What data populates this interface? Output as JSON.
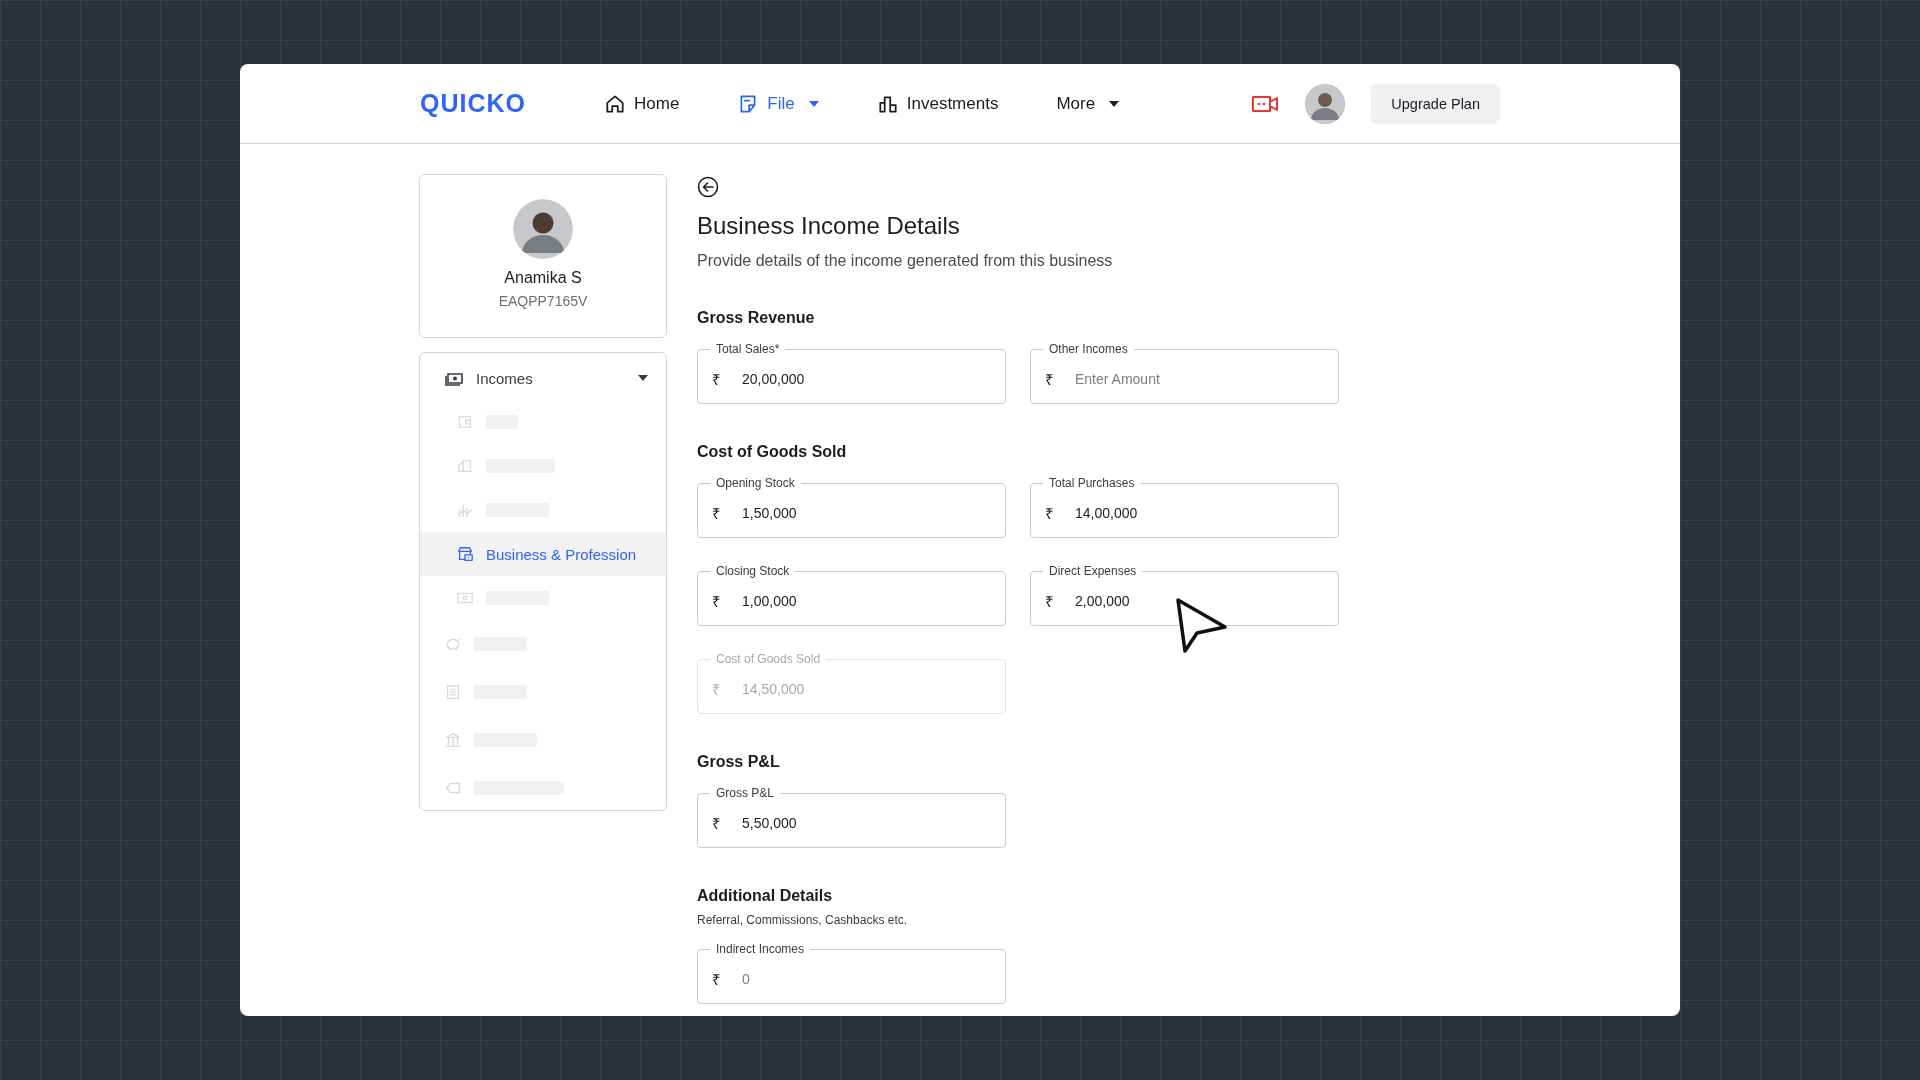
{
  "header": {
    "logo": "QUICKO",
    "nav": [
      {
        "label": "Home",
        "selected": false,
        "has_menu": false
      },
      {
        "label": "File",
        "selected": true,
        "has_menu": true
      },
      {
        "label": "Investments",
        "selected": false,
        "has_menu": false
      },
      {
        "label": "More",
        "selected": false,
        "has_menu": true
      }
    ],
    "upgrade_button": "Upgrade Plan"
  },
  "profile": {
    "name": "Anamika S",
    "pan": "EAQPP7165V"
  },
  "sidebar": {
    "items": [
      {
        "kind": "group",
        "label": "Incomes",
        "expanded": true,
        "children": [
          {
            "kind": "skeleton"
          },
          {
            "kind": "skeleton"
          },
          {
            "kind": "skeleton"
          },
          {
            "kind": "item",
            "label": "Business & Profession",
            "selected": true
          },
          {
            "kind": "skeleton"
          }
        ]
      },
      {
        "kind": "skeleton"
      },
      {
        "kind": "skeleton"
      },
      {
        "kind": "skeleton"
      },
      {
        "kind": "skeleton"
      }
    ]
  },
  "page": {
    "title": "Business Income Details",
    "subtitle": "Provide details of the income generated from this business",
    "sections": [
      {
        "heading": "Gross Revenue",
        "fields": [
          {
            "label": "Total Sales*",
            "currency": "₹",
            "value": "20,00,000",
            "disabled": false
          },
          {
            "label": "Other Incomes",
            "currency": "₹",
            "placeholder": "Enter Amount",
            "disabled": false
          }
        ]
      },
      {
        "heading": "Cost of Goods Sold",
        "fields": [
          {
            "label": "Opening Stock",
            "currency": "₹",
            "value": "1,50,000",
            "disabled": false
          },
          {
            "label": "Total Purchases",
            "currency": "₹",
            "value": "14,00,000",
            "disabled": false
          },
          {
            "label": "Closing Stock",
            "currency": "₹",
            "value": "1,00,000",
            "disabled": false
          },
          {
            "label": "Direct Expenses",
            "currency": "₹",
            "value": "2,00,000",
            "disabled": false
          },
          {
            "label": "Cost of Goods Sold",
            "currency": "₹",
            "value": "14,50,000",
            "disabled": true
          }
        ]
      },
      {
        "heading": "Gross P&L",
        "fields": [
          {
            "label": "Gross P&L",
            "currency": "₹",
            "value": "5,50,000",
            "disabled": false
          }
        ]
      },
      {
        "heading": "Additional Details",
        "note": "Referral, Commissions, Cashbacks etc.",
        "fields": [
          {
            "label": "Indirect Incomes",
            "currency": "₹",
            "placeholder": "0",
            "disabled": false
          }
        ]
      }
    ]
  }
}
